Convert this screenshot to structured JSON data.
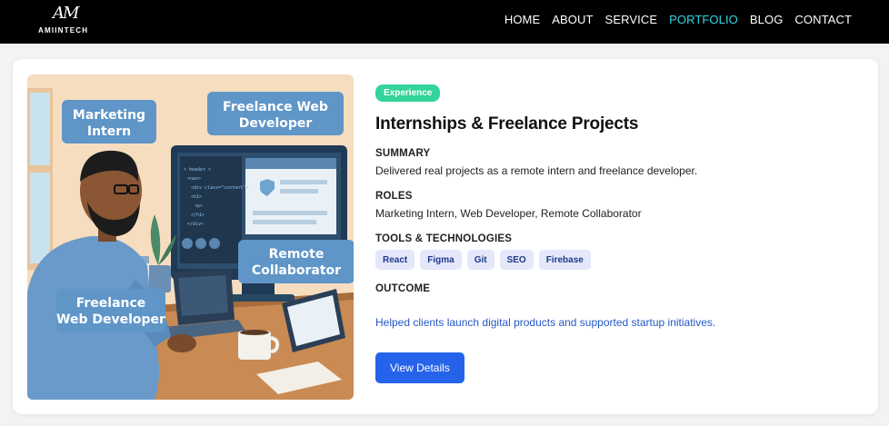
{
  "brand": {
    "mark": "AM",
    "name": "AMIINTECH"
  },
  "nav": {
    "items": [
      {
        "label": "HOME"
      },
      {
        "label": "ABOUT"
      },
      {
        "label": "SERVICE"
      },
      {
        "label": "PORTFOLIO",
        "active": true
      },
      {
        "label": "BLOG"
      },
      {
        "label": "CONTACT"
      }
    ]
  },
  "card": {
    "badge": "Experience",
    "title": "Internships & Freelance Projects",
    "summary": {
      "heading": "SUMMARY",
      "text": "Delivered real projects as a remote intern and freelance developer."
    },
    "roles": {
      "heading": "ROLES",
      "text": "Marketing Intern, Web Developer, Remote Collaborator"
    },
    "tools": {
      "heading": "TOOLS & TECHNOLOGIES",
      "tags": [
        "React",
        "Figma",
        "Git",
        "SEO",
        "Firebase"
      ]
    },
    "outcome": {
      "heading": "OUTCOME",
      "text": "Helped clients launch digital products and supported startup initiatives."
    },
    "cta": "View Details"
  },
  "illustration": {
    "labels": {
      "top_left": [
        "Marketing",
        "Intern"
      ],
      "top_right": [
        "Freelance Web",
        "Developer"
      ],
      "right": [
        "Remote",
        "Collaborator"
      ],
      "bottom_left": [
        "Freelance",
        "Web Developer"
      ]
    },
    "code_lines": [
      "< header >",
      "<nav>",
      "<div class=\"content\">",
      "<h1>",
      "<p>",
      "</h1>",
      "</div>"
    ]
  },
  "colors": {
    "nav_bg": "#000000",
    "active_link": "#33d6e6",
    "badge": "#34d399",
    "button": "#2563eb",
    "outcome": "#2458c7"
  }
}
